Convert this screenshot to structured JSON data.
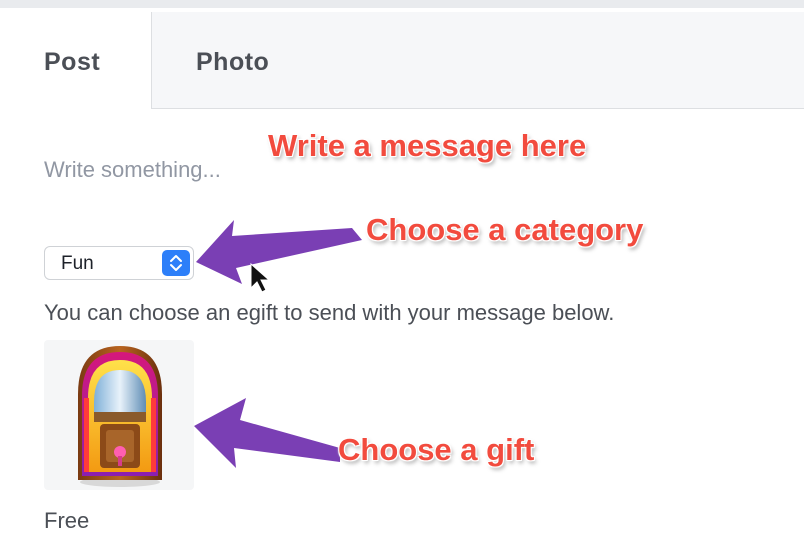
{
  "tabs": [
    {
      "label": "Post",
      "active": true
    },
    {
      "label": "Photo",
      "active": false
    }
  ],
  "composer": {
    "placeholder": "Write something...",
    "value": ""
  },
  "category": {
    "selected": "Fun"
  },
  "gift_section": {
    "help_text": "You can choose an egift to send with your message below.",
    "gift": {
      "icon": "jukebox-icon",
      "price": "Free"
    }
  },
  "annotations": {
    "message": "Write a message here",
    "category": "Choose a category",
    "gift": "Choose a gift"
  },
  "colors": {
    "annotation_text": "#f24b3e",
    "arrow": "#7a3fb4",
    "select_accent": "#2d7ff9"
  }
}
